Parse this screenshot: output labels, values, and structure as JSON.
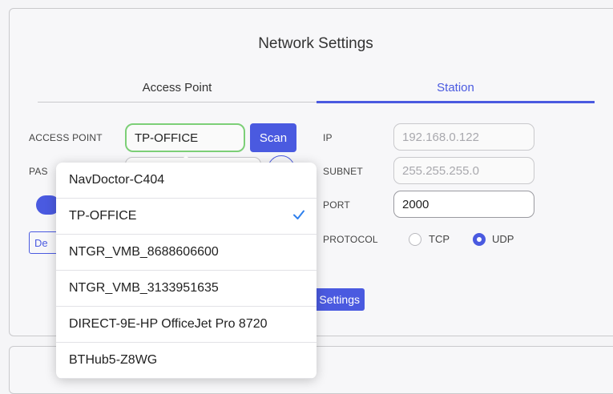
{
  "header": {
    "title": "Network Settings"
  },
  "tabs": [
    {
      "label": "Access Point",
      "active": false
    },
    {
      "label": "Station",
      "active": true
    }
  ],
  "access_point_panel": {
    "access_point_label": "ACCESS POINT",
    "access_point_value": "TP-OFFICE",
    "scan_label": "Scan",
    "password_label_partial": "PAS",
    "partial_button_label": "De"
  },
  "station_panel": {
    "ip_label": "IP",
    "ip_placeholder": "192.168.0.122",
    "subnet_label": "SUBNET",
    "subnet_placeholder": "255.255.255.0",
    "port_label": "PORT",
    "port_value": "2000",
    "protocol_label": "PROTOCOL",
    "protocol_options": [
      "TCP",
      "UDP"
    ],
    "protocol_selected": "UDP",
    "save_button_partial": "Settings"
  },
  "dropdown": {
    "items": [
      {
        "label": "NavDoctor-C404",
        "selected": false
      },
      {
        "label": "TP-OFFICE",
        "selected": true
      },
      {
        "label": "NTGR_VMB_8688606600",
        "selected": false
      },
      {
        "label": "NTGR_VMB_3133951635",
        "selected": false
      },
      {
        "label": "DIRECT-9E-HP OfficeJet Pro 8720",
        "selected": false
      },
      {
        "label": "BTHub5-Z8WG",
        "selected": false
      }
    ]
  },
  "colors": {
    "accent": "#4a5ae0",
    "focus_border": "#7ccf77",
    "check": "#2f80ed"
  },
  "icons": {
    "selected_check": "checkmark-icon"
  }
}
